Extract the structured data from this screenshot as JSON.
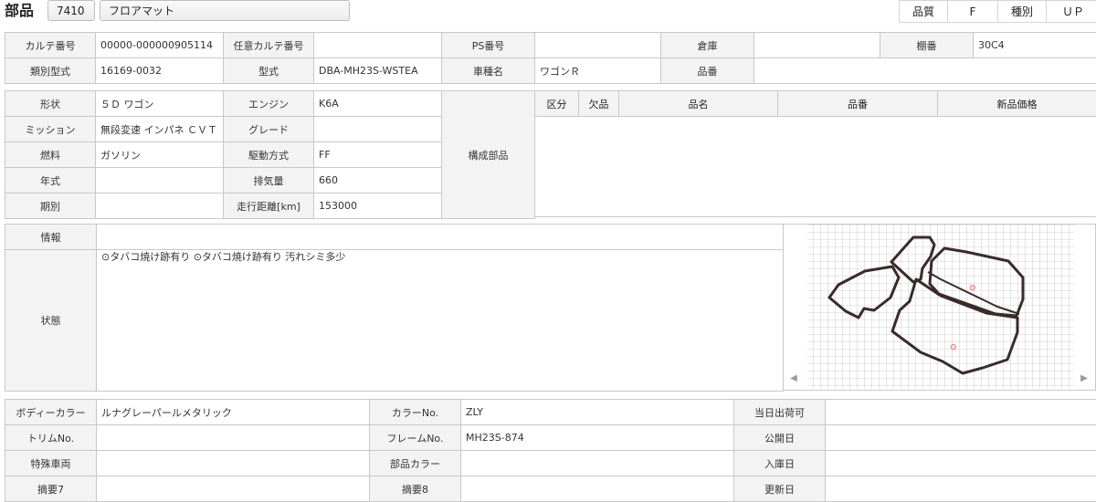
{
  "header": {
    "title": "部品",
    "code": "7410",
    "part_name": "フロアマット",
    "quality_label": "品質",
    "quality_value": "F",
    "kind_label": "種別",
    "kind_value": "ＵＰ"
  },
  "info": {
    "karte_no_label": "カルテ番号",
    "karte_no": "00000-000000905114",
    "opt_karte_label": "任意カルテ番号",
    "opt_karte": "",
    "ps_label": "PS番号",
    "ps": "",
    "warehouse_label": "倉庫",
    "warehouse": "",
    "shelf_label": "棚番",
    "shelf": "30C4",
    "class_label": "類別型式",
    "class": "16169-0032",
    "model_label": "型式",
    "model": "DBA-MH23S-WSTEA",
    "car_label": "車種名",
    "car": "ワゴンＲ",
    "partno_label": "品番",
    "partno": ""
  },
  "spec": {
    "shape_label": "形状",
    "shape": "５Ｄ ワゴン",
    "engine_label": "エンジン",
    "engine": "K6A",
    "mission_label": "ミッション",
    "mission": "無段変速 インパネ ＣＶＴ",
    "grade_label": "グレード",
    "grade": "",
    "fuel_label": "燃料",
    "fuel": "ガソリン",
    "drive_label": "駆動方式",
    "drive": "FF",
    "year_label": "年式",
    "year": "",
    "displacement_label": "排気量",
    "displacement": "660",
    "period_label": "期別",
    "period": "",
    "mileage_label": "走行距離[km]",
    "mileage": "153000",
    "components_label": "構成部品"
  },
  "components_table": {
    "columns": [
      "区分",
      "欠品",
      "品名",
      "品番",
      "新品価格"
    ]
  },
  "notes": {
    "info_label": "情報",
    "info": "",
    "status_label": "状態",
    "status": "⊙タバコ焼け跡有り\n⊙タバコ焼け跡有り\n汚れシミ多少"
  },
  "image_panel": {
    "marker1": "⊙",
    "marker2": "⊙",
    "left_arrow": "◀",
    "right_arrow": "▶"
  },
  "bottom": {
    "body_color_label": "ボディーカラー",
    "body_color": "ルナグレーパールメタリック",
    "color_no_label": "カラーNo.",
    "color_no": "ZLY",
    "ship_label": "当日出荷可",
    "ship": "",
    "trim_label": "トリムNo.",
    "trim": "",
    "frame_label": "フレームNo.",
    "frame": "MH23S-874",
    "public_label": "公開日",
    "public": "",
    "special_label": "特殊車両",
    "special": "",
    "partcolor_label": "部品カラー",
    "partcolor": "",
    "stock_label": "入庫日",
    "stock": "",
    "memo7_label": "摘要7",
    "memo7": "",
    "memo8_label": "摘要8",
    "memo8": "",
    "update_label": "更新日",
    "update": ""
  }
}
